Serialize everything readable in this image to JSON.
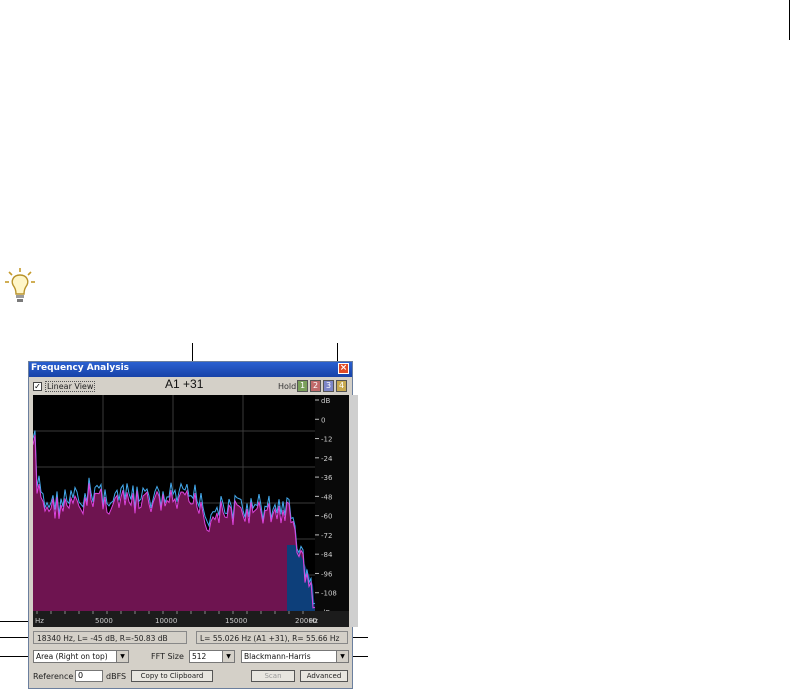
{
  "window": {
    "title": "Frequency Analysis",
    "close_glyph": "×"
  },
  "top": {
    "linear_view_label": "Linear View",
    "linear_view_checked": true,
    "check_glyph": "✓",
    "note_readout": "A1 +31",
    "hold_label": "Hold",
    "hold_buttons": [
      {
        "label": "1",
        "color": "#7aa05a"
      },
      {
        "label": "2",
        "color": "#c06a6a"
      },
      {
        "label": "3",
        "color": "#7c86c8"
      },
      {
        "label": "4",
        "color": "#c8aa50"
      }
    ]
  },
  "graph": {
    "db_labels": [
      "dB",
      "0",
      "-12",
      "-24",
      "-36",
      "-48",
      "-60",
      "-72",
      "-84",
      "-96",
      "-108",
      "dB"
    ],
    "x_labels": [
      "Hz",
      "5000",
      "10000",
      "15000",
      "20000",
      "Hz"
    ],
    "colors": {
      "fill": "#6e1450",
      "left_line": "#dd44dd",
      "right_line": "#44aaee",
      "right_fill": "#0d3f7a",
      "grid": "#3a3a3a"
    }
  },
  "readouts": {
    "cursor": "18340 Hz, L= -45 dB, R=-50.83 dB",
    "peak": "L= 55.026 Hz (A1 +31), R= 55.66 Hz"
  },
  "controls": {
    "graph_type": "Area (Right on top)",
    "fft_label": "FFT Size",
    "fft_size": "512",
    "window_fn": "Blackmann-Harris",
    "reference_label": "Reference",
    "reference_value": "0",
    "dbfs_label": "dBFS",
    "copy_label": "Copy to Clipboard",
    "scan_label": "Scan",
    "advanced_label": "Advanced",
    "dropdown_glyph": "▼"
  },
  "tip_icon": "lightbulb-icon"
}
